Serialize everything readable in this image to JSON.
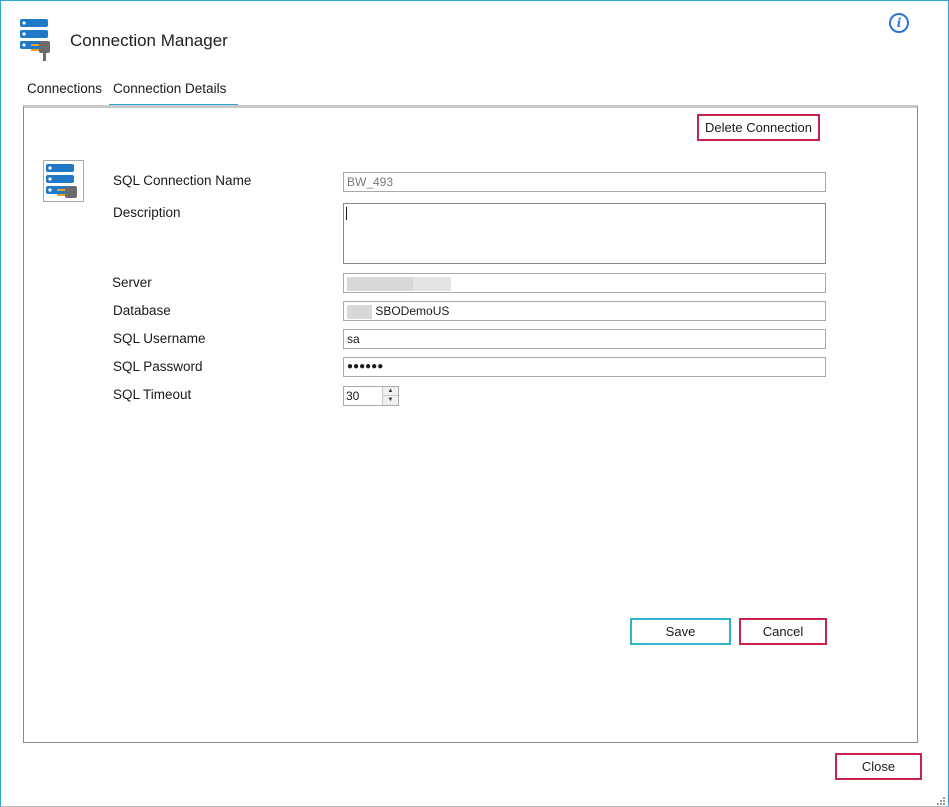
{
  "window": {
    "title": "Connection Manager",
    "accent_color": "#2fa4d4",
    "danger_color": "#c8224d"
  },
  "icons": {
    "app": "database-plug-icon",
    "info": "info-icon",
    "connection": "database-plug-icon",
    "resize": "resize-grip-icon"
  },
  "info_glyph": "i",
  "tabs": [
    {
      "label": "Connections",
      "active": false
    },
    {
      "label": "Connection Details",
      "active": true
    }
  ],
  "details": {
    "delete_label": "Delete Connection",
    "fields": {
      "name": {
        "label": "SQL Connection Name",
        "value": "BW_493"
      },
      "description": {
        "label": "Description",
        "value": ""
      },
      "server": {
        "label": "Server",
        "value": ""
      },
      "database": {
        "label": "Database",
        "value": "SBODemoUS"
      },
      "username": {
        "label": "SQL Username",
        "value": "sa"
      },
      "password": {
        "label": "SQL Password",
        "value": "●●●●●●"
      },
      "timeout": {
        "label": "SQL Timeout",
        "value": "30"
      }
    },
    "save_label": "Save",
    "cancel_label": "Cancel"
  },
  "footer": {
    "close_label": "Close"
  }
}
